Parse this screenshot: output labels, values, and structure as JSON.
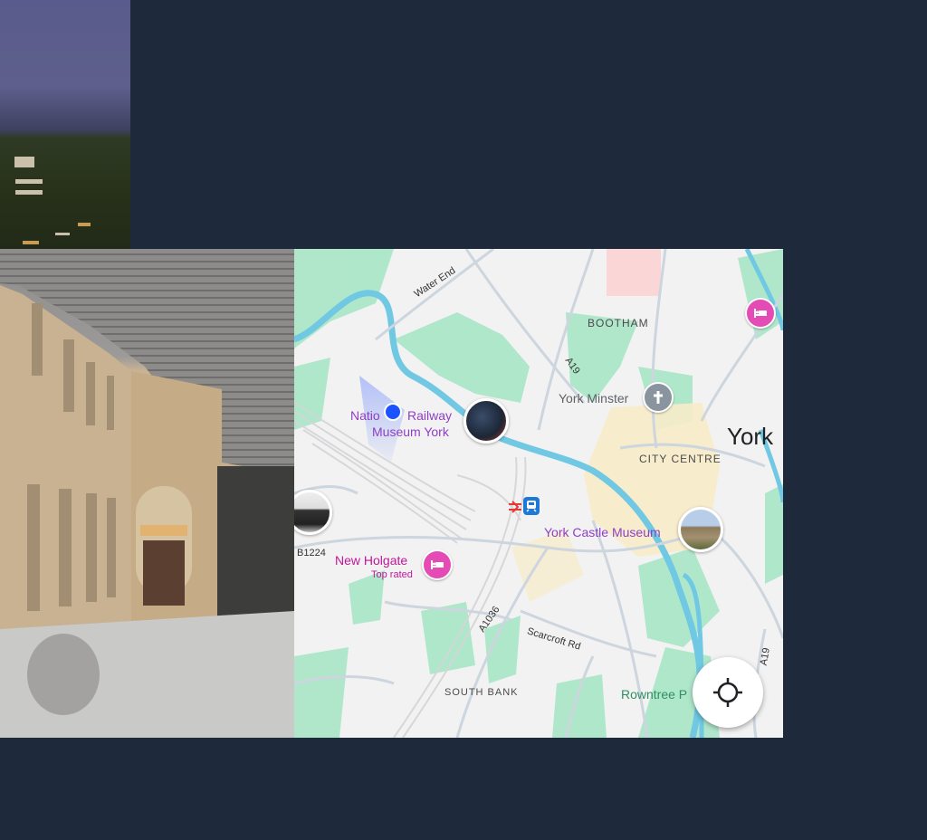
{
  "map": {
    "city_label": "York",
    "districts": {
      "bootham": "BOOTHAM",
      "city_centre": "CITY CENTRE",
      "south_bank": "SOUTH BANK"
    },
    "roads": {
      "water_end": "Water End",
      "a19_north": "A19",
      "a19_south": "A19",
      "a1036": "A1036",
      "scarcroft": "Scarcroft Rd",
      "b1224": "B1224"
    },
    "places": [
      {
        "name": "National Railway Museum York",
        "line1": "Natio",
        "line1b": "Railway",
        "line2": "Museum York",
        "color": "#8e3fc4"
      },
      {
        "name": "York Minster",
        "color": "#5f6368"
      },
      {
        "name": "York Castle Museum",
        "color": "#8e3fc4"
      },
      {
        "name": "New Holgate",
        "sub": "Top rated",
        "color": "#c1179b"
      },
      {
        "name": "Rowntree P",
        "color": "#2f8f64"
      }
    ],
    "icons": {
      "hotel": "hotel-icon",
      "minster": "cross-icon",
      "station": "train-station-icon",
      "rail": "national-rail-icon",
      "locate": "locate-crosshair-icon",
      "location": "current-location-dot"
    },
    "colors": {
      "water": "#70c8e3",
      "park": "#a8e6c7",
      "hotel": "#e44bb5",
      "location": "#1a53ff",
      "centre": "#f7ebc8"
    }
  }
}
